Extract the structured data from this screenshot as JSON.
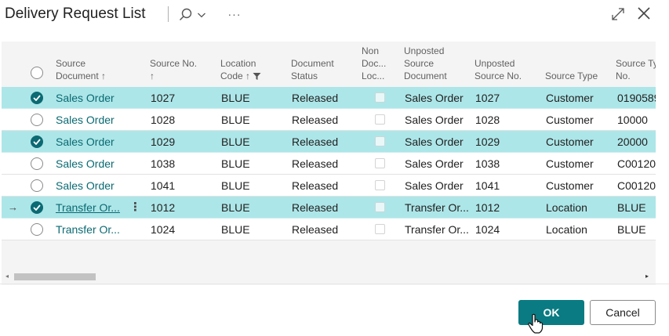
{
  "dialog": {
    "title": "Delivery Request List"
  },
  "icons": {
    "search": "search-icon",
    "chevron": "chevron-down-icon",
    "more": "more-options-icon",
    "expand": "expand-icon",
    "close": "close-icon"
  },
  "toolbar": {
    "more_label": "···"
  },
  "columns": {
    "source_document": [
      "Source",
      "Document ↑"
    ],
    "source_no": [
      "Source No.",
      "↑"
    ],
    "location_code": [
      "Location",
      "Code ↑"
    ],
    "document_status": [
      "Document",
      "Status"
    ],
    "non_doc": [
      "Non",
      "Doc...",
      "Loc..."
    ],
    "unposted_source_document": [
      "Unposted",
      "Source",
      "Document"
    ],
    "unposted_source_no": [
      "Unposted",
      "Source No."
    ],
    "source_type": [
      "Source Type"
    ],
    "source_type_no": [
      "Source Ty",
      "No."
    ]
  },
  "rows": [
    {
      "selected": true,
      "current": false,
      "source_document": "Sales Order",
      "source_no": "1027",
      "location_code": "BLUE",
      "document_status": "Released",
      "unposted_source_document": "Sales Order",
      "unposted_source_no": "1027",
      "source_type": "Customer",
      "source_type_no": "0190589"
    },
    {
      "selected": false,
      "current": false,
      "source_document": "Sales Order",
      "source_no": "1028",
      "location_code": "BLUE",
      "document_status": "Released",
      "unposted_source_document": "Sales Order",
      "unposted_source_no": "1028",
      "source_type": "Customer",
      "source_type_no": "10000"
    },
    {
      "selected": true,
      "current": false,
      "source_document": "Sales Order",
      "source_no": "1029",
      "location_code": "BLUE",
      "document_status": "Released",
      "unposted_source_document": "Sales Order",
      "unposted_source_no": "1029",
      "source_type": "Customer",
      "source_type_no": "20000"
    },
    {
      "selected": false,
      "current": false,
      "source_document": "Sales Order",
      "source_no": "1038",
      "location_code": "BLUE",
      "document_status": "Released",
      "unposted_source_document": "Sales Order",
      "unposted_source_no": "1038",
      "source_type": "Customer",
      "source_type_no": "C00120"
    },
    {
      "selected": false,
      "current": false,
      "source_document": "Sales Order",
      "source_no": "1041",
      "location_code": "BLUE",
      "document_status": "Released",
      "unposted_source_document": "Sales Order",
      "unposted_source_no": "1041",
      "source_type": "Customer",
      "source_type_no": "C00120"
    },
    {
      "selected": true,
      "current": true,
      "source_document": "Transfer Or...",
      "source_no": "1012",
      "location_code": "BLUE",
      "document_status": "Released",
      "unposted_source_document": "Transfer Or...",
      "unposted_source_no": "1012",
      "source_type": "Location",
      "source_type_no": "BLUE"
    },
    {
      "selected": false,
      "current": false,
      "source_document": "Transfer Or...",
      "source_no": "1024",
      "location_code": "BLUE",
      "document_status": "Released",
      "unposted_source_document": "Transfer Or...",
      "unposted_source_no": "1024",
      "source_type": "Location",
      "source_type_no": "BLUE"
    }
  ],
  "current_row_marker": "→",
  "row_menu": "⋮",
  "scrollbar": {
    "left_arrow": "◂",
    "right_arrow": "▸"
  },
  "buttons": {
    "ok": "OK",
    "cancel": "Cancel"
  },
  "colors": {
    "accent": "#0a7b82",
    "selected_row": "#ade6e8",
    "link": "#0a6a72"
  }
}
